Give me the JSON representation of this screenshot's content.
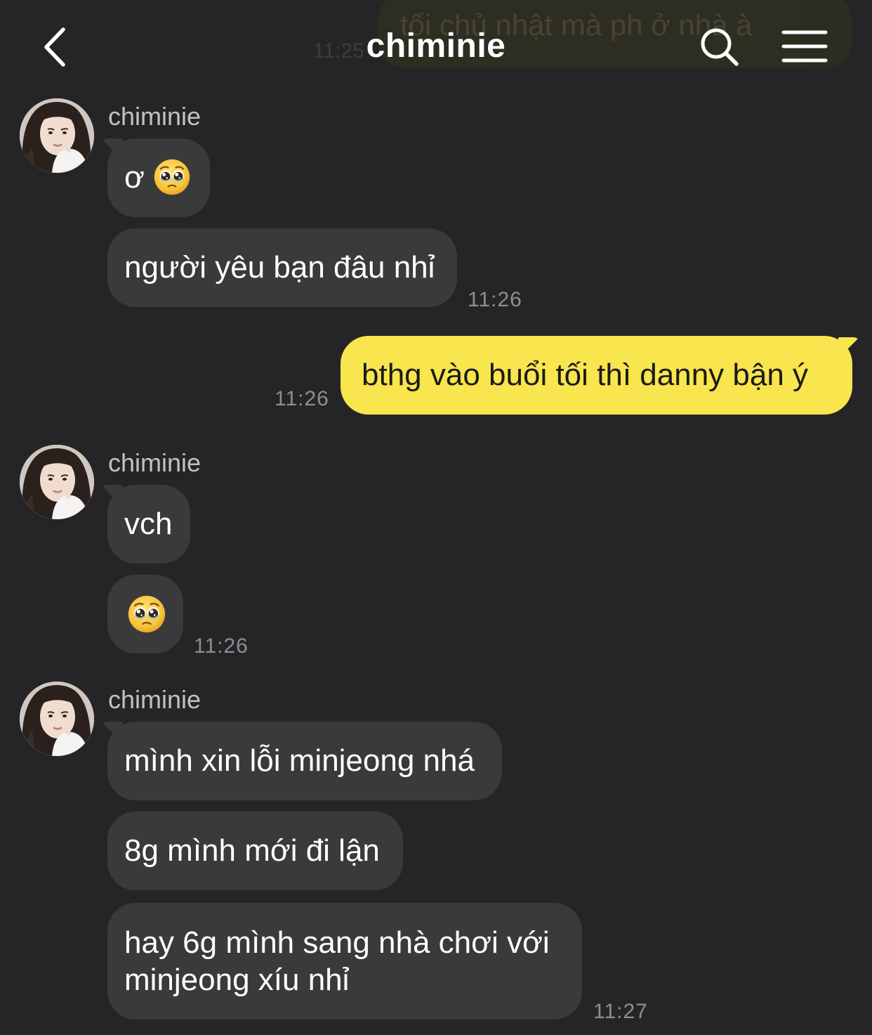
{
  "header": {
    "title": "chiminie",
    "back_icon": "chevron-left-icon",
    "search_icon": "search-icon",
    "menu_icon": "menu-icon"
  },
  "previous_message": {
    "text": "tối chủ nhật mà ph ở nhà à",
    "time": "11:25"
  },
  "colors": {
    "background": "#252527",
    "incoming_bubble": "#3a3a3c",
    "outgoing_bubble": "#f9e54d",
    "timestamp": "#8e8e93"
  },
  "groups": [
    {
      "sender": "chiminie",
      "messages": [
        {
          "text": "ơ",
          "emoji": "pleading-face-emoji"
        },
        {
          "text": "người yêu bạn đâu nhỉ",
          "time": "11:26"
        }
      ]
    },
    {
      "sender": "me",
      "messages": [
        {
          "text": "bthg vào buổi tối thì danny bận ý",
          "time": "11:26"
        }
      ]
    },
    {
      "sender": "chiminie",
      "messages": [
        {
          "text": "vch"
        },
        {
          "emoji": "pleading-face-emoji",
          "time": "11:26"
        }
      ]
    },
    {
      "sender": "chiminie",
      "messages": [
        {
          "text": "mình xin lỗi minjeong nhá"
        },
        {
          "text": "8g mình mới đi lận"
        },
        {
          "text": "hay 6g mình sang nhà chơi với minjeong xíu nhỉ",
          "time": "11:27"
        }
      ]
    }
  ]
}
